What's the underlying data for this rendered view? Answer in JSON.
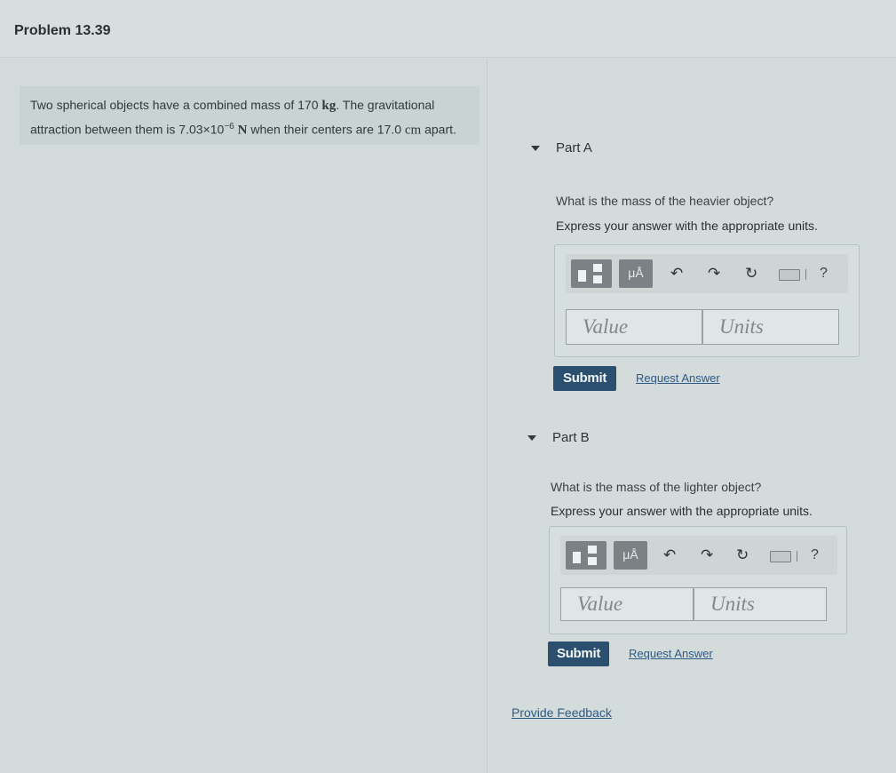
{
  "header": {
    "title": "Problem 13.39"
  },
  "problem": {
    "text1": "Two spherical objects have a combined mass of 170 ",
    "unit_kg": "kg",
    "text2": ". The gravitational",
    "text3": "attraction between them is 7.03×10",
    "exponent": "−6",
    "unit_n": "N",
    "text4": " when their centers are 17.0 ",
    "unit_cm": "cm",
    "text5": " apart."
  },
  "parts": [
    {
      "label": "Part A",
      "question": "What is the mass of the heavier object?",
      "instruction": "Express your answer with the appropriate units.",
      "value_placeholder": "Value",
      "units_placeholder": "Units",
      "submit": "Submit",
      "request": "Request Answer"
    },
    {
      "label": "Part B",
      "question": "What is the mass of the lighter object?",
      "instruction": "Express your answer with the appropriate units.",
      "value_placeholder": "Value",
      "units_placeholder": "Units",
      "submit": "Submit",
      "request": "Request Answer"
    }
  ],
  "toolbar": {
    "mu_label": "μÅ",
    "undo": "↶",
    "redo": "↷",
    "reset": "↻",
    "help": "?"
  },
  "feedback": "Provide Feedback"
}
